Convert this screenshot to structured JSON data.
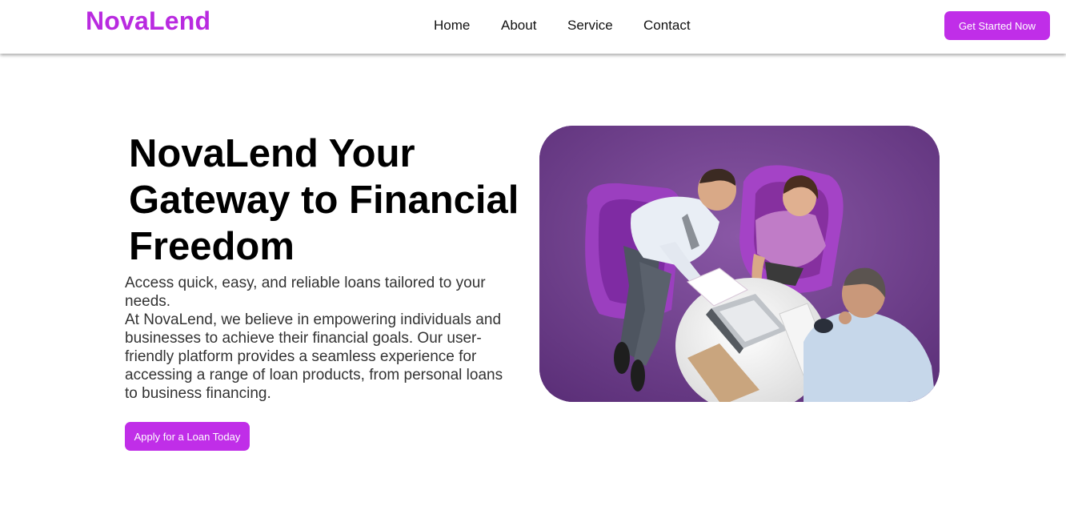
{
  "header": {
    "logo_text": "NovaLend",
    "nav": [
      {
        "label": "Home"
      },
      {
        "label": "About"
      },
      {
        "label": "Service"
      },
      {
        "label": "Contact"
      }
    ],
    "cta_label": "Get Started Now"
  },
  "hero": {
    "title": "NovaLend Your Gateway to Financial Freedom",
    "tagline": "Access quick, easy, and reliable loans tailored to your needs.",
    "description": "At NovaLend, we believe in empowering individuals and businesses to achieve their financial goals. Our user-friendly platform provides a seamless experience for accessing a range of loan products, from personal loans to business financing.",
    "button_label": "Apply for a Loan Today"
  },
  "colors": {
    "brand": "#b92ae0",
    "button": "#c02ee8",
    "carpet": "#6a3a86"
  }
}
